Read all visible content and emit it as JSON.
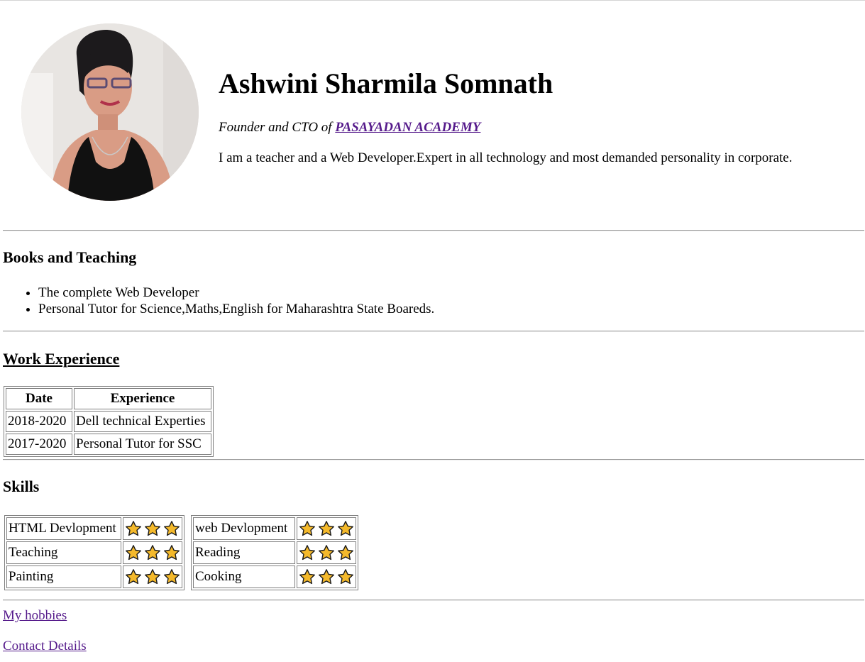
{
  "profile": {
    "name": "Ashwini Sharmila Somnath",
    "role_prefix": "Founder and CTO of",
    "company": "PASAYADAN ACADEMY",
    "bio": "I am a teacher and a Web Developer.Expert in all technology and most demanded personality in corporate.",
    "avatar_icon": "profile-photo"
  },
  "books": {
    "heading": "Books and Teaching",
    "items": [
      "The complete Web Developer",
      "Personal Tutor for Science,Maths,English for Maharashtra State Boareds."
    ]
  },
  "work": {
    "heading": "Work Experience",
    "columns": [
      "Date",
      "Experience"
    ],
    "rows": [
      [
        "2018-2020",
        "Dell technical Experties"
      ],
      [
        "2017-2020",
        "Personal Tutor for SSC"
      ]
    ]
  },
  "skills": {
    "heading": "Skills",
    "left": [
      {
        "name": "HTML Devlopment",
        "rating": 3
      },
      {
        "name": "Teaching",
        "rating": 3
      },
      {
        "name": "Painting",
        "rating": 3
      }
    ],
    "right": [
      {
        "name": "web Devlopment",
        "rating": 3
      },
      {
        "name": "Reading",
        "rating": 3
      },
      {
        "name": "Cooking",
        "rating": 3
      }
    ],
    "star_color": "#f4b92b",
    "star_icon": "star-icon"
  },
  "links": {
    "hobbies": "My hobbies",
    "contact": "Contact Details"
  },
  "colors": {
    "visited_link": "#551a8b",
    "rule": "#9a9a9a"
  }
}
